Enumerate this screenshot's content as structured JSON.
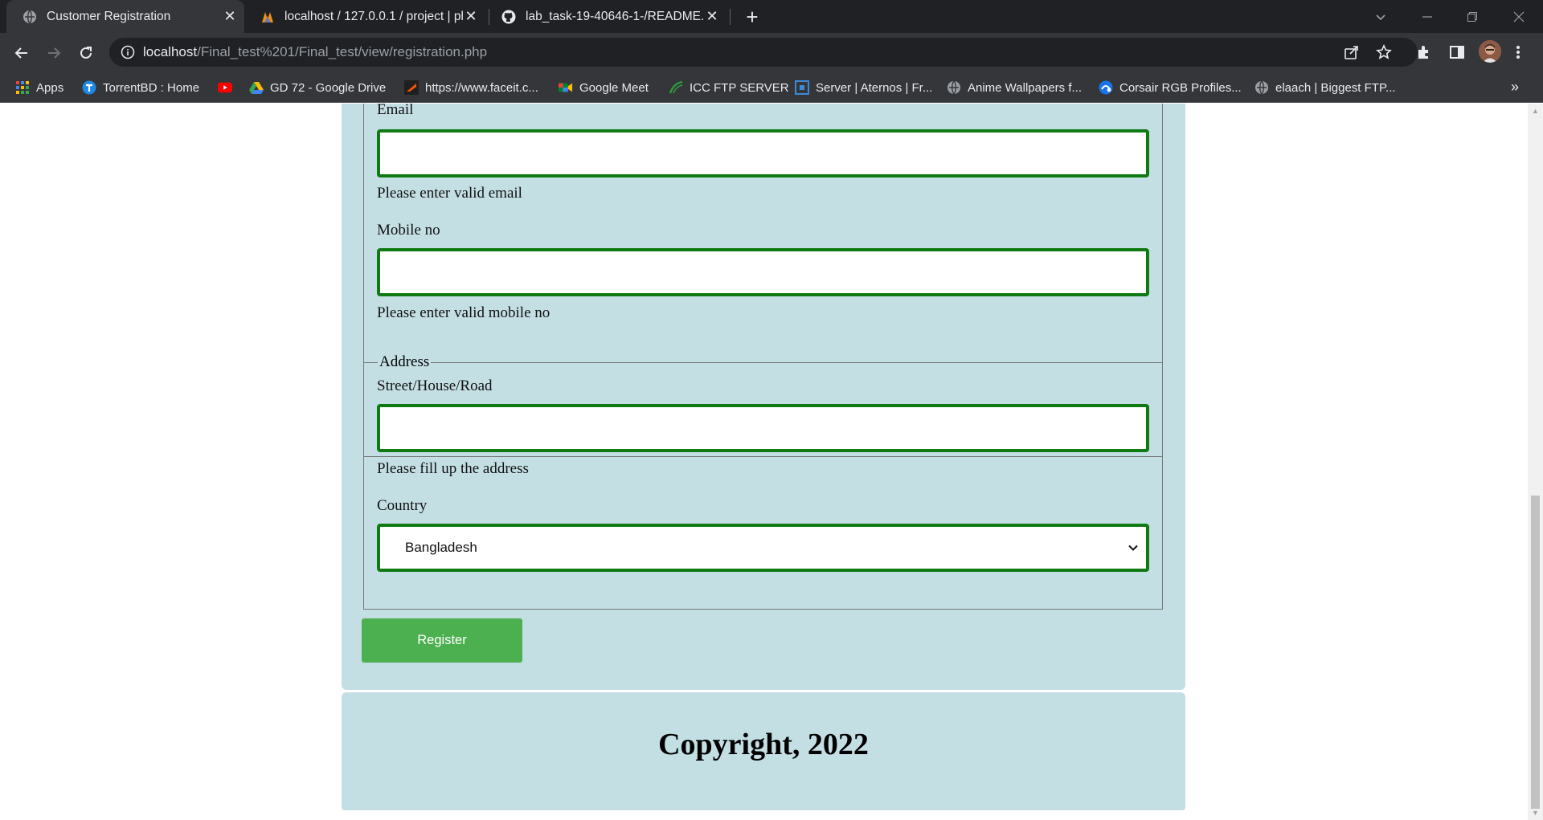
{
  "browser": {
    "tabs": [
      {
        "title": "Customer Registration",
        "active": true
      },
      {
        "title": "localhost / 127.0.0.1 / project | ph",
        "active": false
      },
      {
        "title": "lab_task-19-40646-1-/README.m",
        "active": false
      }
    ],
    "url_host": "localhost",
    "url_path": "/Final_test%201/Final_test/view/registration.php",
    "bookmarks": [
      {
        "label": "Apps",
        "icon": "apps-grid-icon"
      },
      {
        "label": "TorrentBD : Home",
        "icon": "torrentbd-icon"
      },
      {
        "label": "",
        "icon": "youtube-icon"
      },
      {
        "label": "GD 72 - Google Drive",
        "icon": "google-drive-icon"
      },
      {
        "label": "https://www.faceit.c...",
        "icon": "faceit-icon"
      },
      {
        "label": "Google Meet",
        "icon": "google-meet-icon"
      },
      {
        "label": "ICC FTP SERVER",
        "icon": "icc-icon"
      },
      {
        "label": "Server | Aternos | Fr...",
        "icon": "aternos-icon"
      },
      {
        "label": "Anime Wallpapers f...",
        "icon": "globe-icon"
      },
      {
        "label": "Corsair RGB Profiles...",
        "icon": "corsair-icon"
      },
      {
        "label": "elaach | Biggest FTP...",
        "icon": "globe-icon"
      }
    ],
    "bookmarks_overflow": "»"
  },
  "form": {
    "email_label": "Email",
    "email_value": "",
    "email_error": "Please enter valid email",
    "mobile_label": "Mobile no",
    "mobile_value": "",
    "mobile_error": "Please enter valid mobile no",
    "address_legend": "Address",
    "street_label": "Street/House/Road",
    "street_value": "",
    "street_error": "Please fill up the address",
    "country_label": "Country",
    "country_selected": "Bangladesh",
    "register_label": "Register"
  },
  "footer": {
    "copyright": "Copyright, 2022"
  },
  "colors": {
    "panel_bg": "#c4dfe4",
    "input_border": "#0f7a12",
    "button_bg": "#4caf50"
  }
}
